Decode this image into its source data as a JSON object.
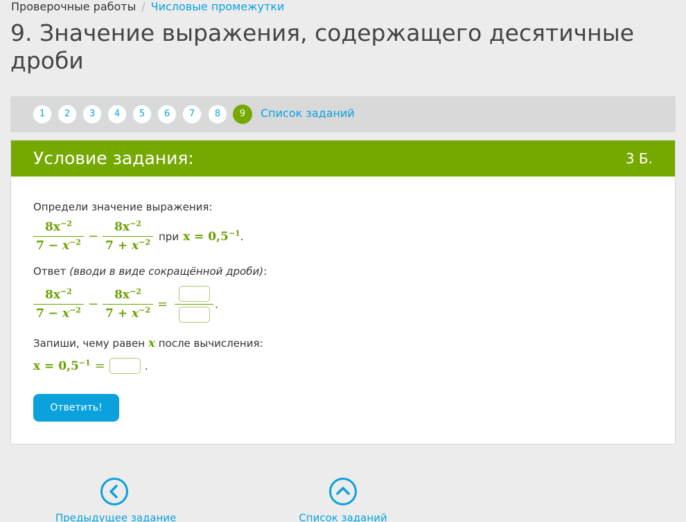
{
  "breadcrumb": {
    "parent": "Проверочные работы",
    "separator": "/",
    "current": "Числовые промежутки"
  },
  "page": {
    "title": "9. Значение выражения, содержащего десятичные дроби"
  },
  "task_nav": {
    "numbers": [
      "1",
      "2",
      "3",
      "4",
      "5",
      "6",
      "7",
      "8",
      "9"
    ],
    "active": "9",
    "list_link": "Список заданий"
  },
  "card": {
    "header_title": "Условие задания:",
    "points": "3 Б.",
    "prompt": "Определи значение выражения:",
    "expr": {
      "num1": "8x",
      "num1_exp": "−2",
      "den1_a": "7",
      "den1_op": "−",
      "den1_x": "x",
      "den1_exp": "−2",
      "minus": "−",
      "num2": "8x",
      "num2_exp": "−2",
      "den2_a": "7",
      "den2_op": "+",
      "den2_x": "x",
      "den2_exp": "−2",
      "at_word": "при",
      "x_eq": "x = 0,5",
      "x_exp": "−1",
      "end": ".",
      "equals": "="
    },
    "answer_label": "Ответ",
    "answer_hint": "(вводи в виде сокращённой дроби)",
    "answer_colon": ":",
    "x_prompt_before": "Запиши, чему равен",
    "x_var": "x",
    "x_prompt_after": "после вычисления:",
    "x_line": {
      "lhs": "x = 0,5",
      "exp": "−1",
      "eq": "=",
      "end": "."
    },
    "submit": "Ответить!"
  },
  "bottom_nav": {
    "prev": "Предыдущее задание",
    "list": "Список заданий"
  },
  "colors": {
    "accent_green": "#75a800",
    "link_blue": "#0aa1dd",
    "background": "#ececec"
  },
  "icons": {
    "prev": "chevron-left-icon",
    "list": "chevron-up-icon"
  }
}
